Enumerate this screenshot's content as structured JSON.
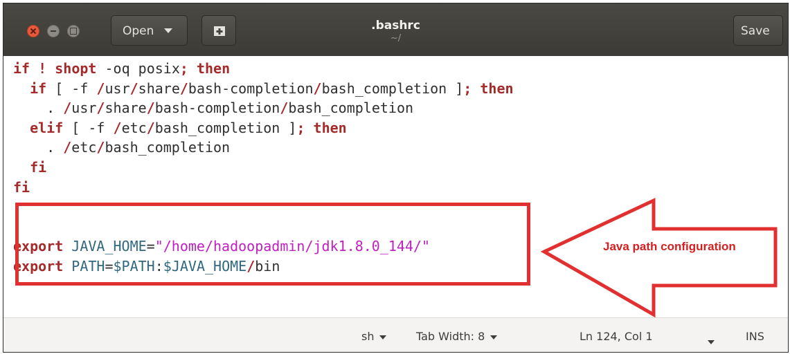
{
  "window": {
    "title": ".bashrc",
    "subtitle": "~/",
    "open_label": "Open",
    "save_label": "Save"
  },
  "editor": {
    "lines": [
      [
        {
          "t": "if",
          "c": "kw"
        },
        {
          "t": " ",
          "c": "pl"
        },
        {
          "t": "!",
          "c": "kw"
        },
        {
          "t": " ",
          "c": "pl"
        },
        {
          "t": "shopt",
          "c": "kw"
        },
        {
          "t": " -oq posix",
          "c": "pl"
        },
        {
          "t": ";",
          "c": "kw"
        },
        {
          "t": " ",
          "c": "pl"
        },
        {
          "t": "then",
          "c": "kw"
        }
      ],
      [
        {
          "t": "  ",
          "c": "pl"
        },
        {
          "t": "if",
          "c": "kw"
        },
        {
          "t": " [ -f ",
          "c": "pl"
        },
        {
          "t": "/",
          "c": "sl"
        },
        {
          "t": "usr",
          "c": "pl"
        },
        {
          "t": "/",
          "c": "sl"
        },
        {
          "t": "share",
          "c": "pl"
        },
        {
          "t": "/",
          "c": "sl"
        },
        {
          "t": "bash-completion",
          "c": "pl"
        },
        {
          "t": "/",
          "c": "sl"
        },
        {
          "t": "bash_completion ]",
          "c": "pl"
        },
        {
          "t": ";",
          "c": "kw"
        },
        {
          "t": " ",
          "c": "pl"
        },
        {
          "t": "then",
          "c": "kw"
        }
      ],
      [
        {
          "t": "    . ",
          "c": "pl"
        },
        {
          "t": "/",
          "c": "sl"
        },
        {
          "t": "usr",
          "c": "pl"
        },
        {
          "t": "/",
          "c": "sl"
        },
        {
          "t": "share",
          "c": "pl"
        },
        {
          "t": "/",
          "c": "sl"
        },
        {
          "t": "bash-completion",
          "c": "pl"
        },
        {
          "t": "/",
          "c": "sl"
        },
        {
          "t": "bash_completion",
          "c": "pl"
        }
      ],
      [
        {
          "t": "  ",
          "c": "pl"
        },
        {
          "t": "elif",
          "c": "kw"
        },
        {
          "t": " [ -f ",
          "c": "pl"
        },
        {
          "t": "/",
          "c": "sl"
        },
        {
          "t": "etc",
          "c": "pl"
        },
        {
          "t": "/",
          "c": "sl"
        },
        {
          "t": "bash_completion ]",
          "c": "pl"
        },
        {
          "t": ";",
          "c": "kw"
        },
        {
          "t": " ",
          "c": "pl"
        },
        {
          "t": "then",
          "c": "kw"
        }
      ],
      [
        {
          "t": "    . ",
          "c": "pl"
        },
        {
          "t": "/",
          "c": "sl"
        },
        {
          "t": "etc",
          "c": "pl"
        },
        {
          "t": "/",
          "c": "sl"
        },
        {
          "t": "bash_completion",
          "c": "pl"
        }
      ],
      [
        {
          "t": "  ",
          "c": "pl"
        },
        {
          "t": "fi",
          "c": "kw"
        }
      ],
      [
        {
          "t": "fi",
          "c": "kw"
        }
      ],
      [],
      [],
      [
        {
          "t": "export",
          "c": "kw"
        },
        {
          "t": " ",
          "c": "pl"
        },
        {
          "t": "JAVA_HOME",
          "c": "var"
        },
        {
          "t": "=",
          "c": "pl"
        },
        {
          "t": "\"/home/hadoopadmin/jdk1.8.0_144/\"",
          "c": "str"
        }
      ],
      [
        {
          "t": "export",
          "c": "kw"
        },
        {
          "t": " ",
          "c": "pl"
        },
        {
          "t": "PATH",
          "c": "var"
        },
        {
          "t": "=",
          "c": "pl"
        },
        {
          "t": "$PATH",
          "c": "var"
        },
        {
          "t": ":",
          "c": "pl"
        },
        {
          "t": "$JAVA_HOME",
          "c": "var"
        },
        {
          "t": "/",
          "c": "sl"
        },
        {
          "t": "bin",
          "c": "pl"
        }
      ]
    ]
  },
  "annotation": {
    "label": "Java path configuration",
    "color": "#e03030"
  },
  "statusbar": {
    "language": "sh",
    "tab_width": "Tab Width: 8",
    "position": "Ln 124, Col 1",
    "mode": "INS"
  },
  "colors": {
    "titlebar": "#3c3b37",
    "keyword": "#a52a2a",
    "variable": "#306880",
    "string": "#c020c0"
  }
}
